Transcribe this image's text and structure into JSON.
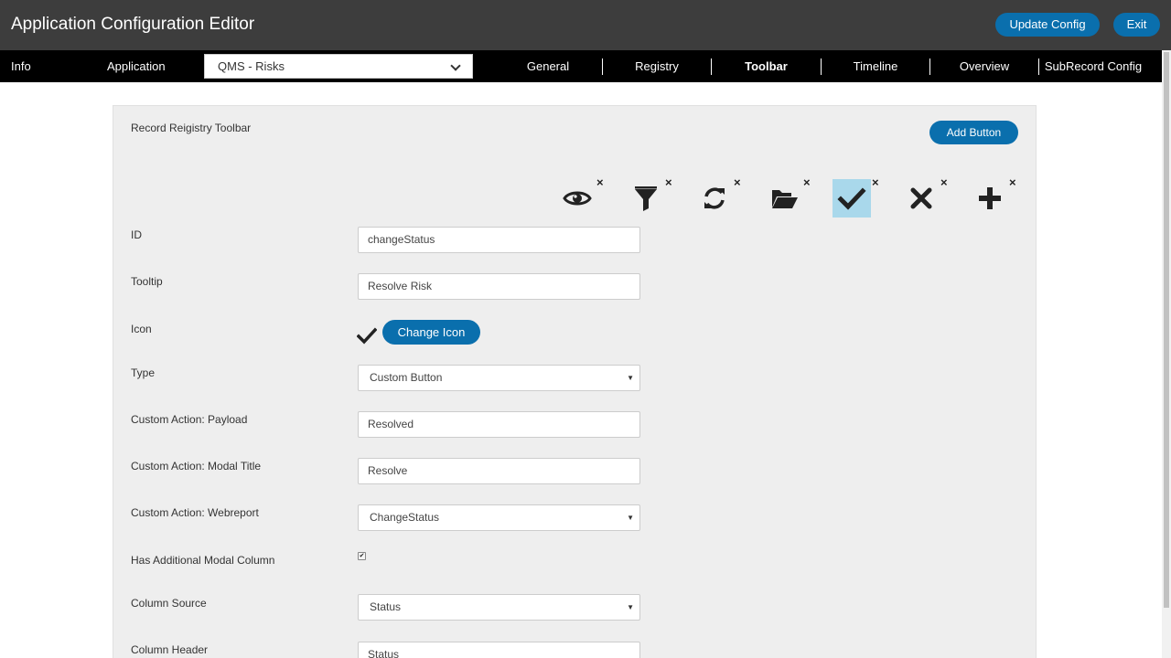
{
  "header": {
    "title": "Application Configuration Editor",
    "update_label": "Update Config",
    "exit_label": "Exit"
  },
  "nav": {
    "info_label": "Info",
    "application_label": "Application",
    "application_value": "QMS - Risks",
    "tabs": [
      {
        "label": "General"
      },
      {
        "label": "Registry"
      },
      {
        "label": "Toolbar"
      },
      {
        "label": "Timeline"
      },
      {
        "label": "Overview"
      },
      {
        "label": "SubRecord Config"
      }
    ],
    "active_tab": "Toolbar"
  },
  "panel": {
    "title": "Record Reigistry Toolbar",
    "add_button_label": "Add Button",
    "toolbar_icons": [
      {
        "icon": "eye-icon"
      },
      {
        "icon": "filter-icon"
      },
      {
        "icon": "refresh-icon"
      },
      {
        "icon": "folder-open-icon"
      },
      {
        "icon": "check-icon",
        "selected": true
      },
      {
        "icon": "times-icon"
      },
      {
        "icon": "plus-icon"
      }
    ],
    "remove_glyph": "×",
    "selected_color": "#a9d8eb"
  },
  "form": {
    "id": {
      "label": "ID",
      "value": "changeStatus"
    },
    "tooltip": {
      "label": "Tooltip",
      "value": "Resolve Risk"
    },
    "icon": {
      "label": "Icon",
      "change_label": "Change Icon",
      "current_icon": "check-icon"
    },
    "type": {
      "label": "Type",
      "value": "Custom Button"
    },
    "payload": {
      "label": "Custom Action: Payload",
      "value": "Resolved"
    },
    "modal_title": {
      "label": "Custom Action: Modal Title",
      "value": "Resolve"
    },
    "webreport": {
      "label": "Custom Action: Webreport",
      "value": "ChangeStatus"
    },
    "has_modal_column": {
      "label": "Has Additional Modal Column",
      "checked": true
    },
    "column_source": {
      "label": "Column Source",
      "value": "Status"
    },
    "column_header": {
      "label": "Column Header",
      "value": "Status"
    }
  },
  "colors": {
    "accent": "#0a6fad",
    "header_bg": "#3d3d3d",
    "nav_bg": "#000000",
    "panel_bg": "#eeeeee"
  }
}
